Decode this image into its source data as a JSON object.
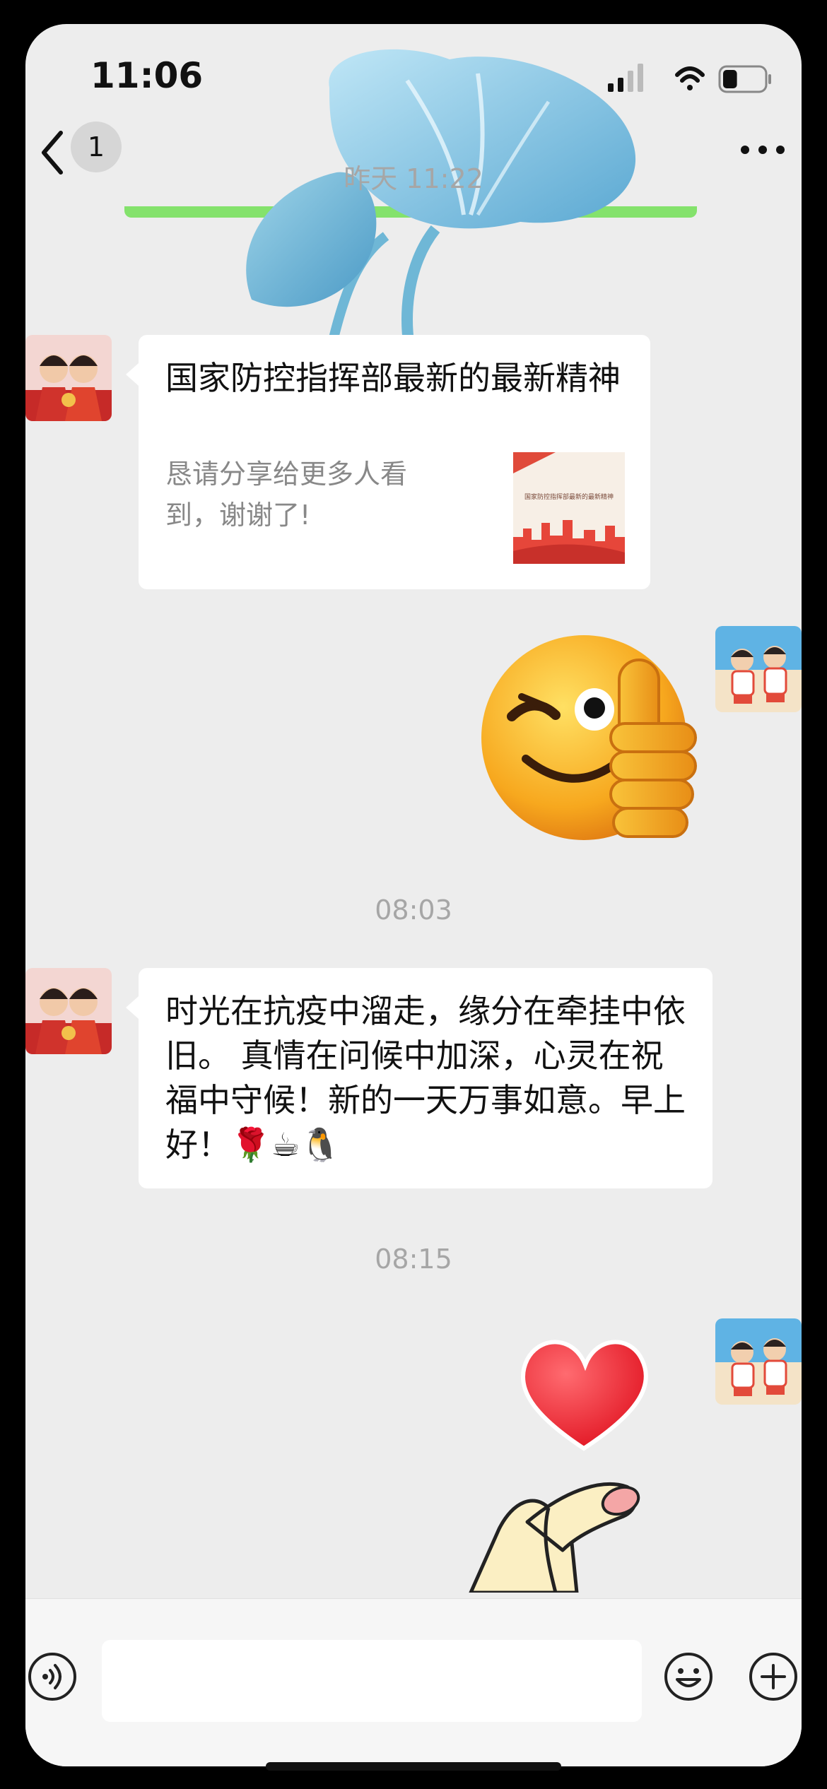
{
  "status_bar": {
    "time": "11:06",
    "battery_level": 0.35
  },
  "nav": {
    "unread_count": "1"
  },
  "messages": [
    {
      "type": "timestamp",
      "text": "昨天 11:22"
    },
    {
      "type": "card",
      "from": "other",
      "title": "国家防控指挥部最新的最新精神",
      "description": "恳请分享给更多人看到，谢谢了!",
      "thumb_text": "国家防控指挥部最新的最新精神"
    },
    {
      "type": "sticker",
      "from": "me",
      "sticker": "wink-thumbs-up-emoji"
    },
    {
      "type": "timestamp",
      "text": "08:03"
    },
    {
      "type": "text",
      "from": "other",
      "text": "时光在抗疫中溜走，缘分在牵挂中依旧。 真情在问候中加深，心灵在祝福中守候！新的一天万事如意。早上好！🌹☕🐧"
    },
    {
      "type": "timestamp",
      "text": "08:15"
    },
    {
      "type": "sticker",
      "from": "me",
      "sticker": "finger-heart-sticker"
    }
  ],
  "input_bar": {
    "placeholder": ""
  },
  "colors": {
    "background": "#ededed",
    "bubble": "#ffffff",
    "accent_green": "#84e26c",
    "timestamp": "#a6a6a6"
  },
  "icons": [
    "back-chevron-icon",
    "more-dots-icon",
    "voice-icon",
    "emoji-icon",
    "plus-icon",
    "signal-icon",
    "wifi-icon",
    "battery-icon"
  ]
}
